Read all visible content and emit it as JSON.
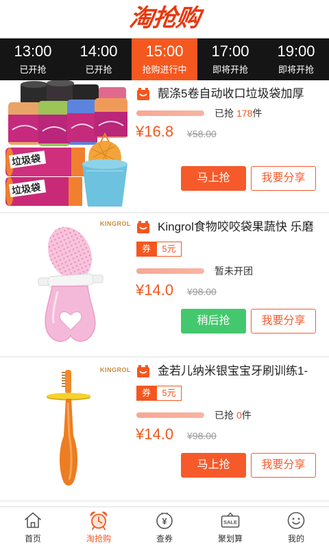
{
  "app": {
    "logo_text": "淘抢购",
    "colors": {
      "accent": "#f5561f",
      "buy_button": "#f65a2b",
      "later_button": "#44c86d",
      "tab_bar": "#151515",
      "active_tab": "#f5581f",
      "progress_track": "#f9b4a2"
    }
  },
  "time_tabs": [
    {
      "time": "13:00",
      "status": "已开抢",
      "active": false
    },
    {
      "time": "14:00",
      "status": "已开抢",
      "active": false
    },
    {
      "time": "15:00",
      "status": "抢购进行中",
      "active": true
    },
    {
      "time": "17:00",
      "status": "即将开抢",
      "active": false
    },
    {
      "time": "19:00",
      "status": "即将开抢",
      "active": false
    }
  ],
  "products": [
    {
      "title": "靓涤5卷自动收口垃圾袋加厚",
      "title_icon": "shop-bag-icon",
      "image": {
        "icon": "garbage-bags-image",
        "package_text": "垃圾袋"
      },
      "sold_label": "已抢",
      "sold_count": "178",
      "sold_unit": "件",
      "price": "¥16.8",
      "original_price": "¥58.00",
      "action_button": "马上抢",
      "share_button": "我要分享"
    },
    {
      "title": "Kingrol食物咬咬袋果蔬快 乐磨",
      "title_icon": "shop-bag-icon",
      "image": {
        "icon": "baby-food-feeder-image",
        "brand_logo": "KINGROL"
      },
      "coupon": {
        "label": "券",
        "value": "5元"
      },
      "status_text": "暂未开团",
      "price": "¥14.0",
      "original_price": "¥98.00",
      "action_button": "稍后抢",
      "share_button": "我要分享"
    },
    {
      "title": "金若儿纳米银宝宝牙刷训练1-",
      "title_icon": "shop-bag-icon",
      "image": {
        "icon": "baby-toothbrush-image",
        "brand_logo": "KINGROL"
      },
      "coupon": {
        "label": "券",
        "value": "5元"
      },
      "sold_label": "已抢",
      "sold_count": "0",
      "sold_unit": "件",
      "price": "¥14.0",
      "original_price": "¥98.00",
      "action_button": "马上抢",
      "share_button": "我要分享"
    }
  ],
  "bottom_nav": [
    {
      "label": "首页",
      "icon": "home-icon",
      "active": false
    },
    {
      "label": "淘抢购",
      "icon": "alarm-clock-icon",
      "active": true
    },
    {
      "label": "查券",
      "icon": "coupon-coin-icon",
      "icon_text": "¥",
      "active": false
    },
    {
      "label": "聚划算",
      "icon": "sale-tag-icon",
      "icon_text": "SALE",
      "active": false
    },
    {
      "label": "我的",
      "icon": "smiley-face-icon",
      "active": false
    }
  ]
}
